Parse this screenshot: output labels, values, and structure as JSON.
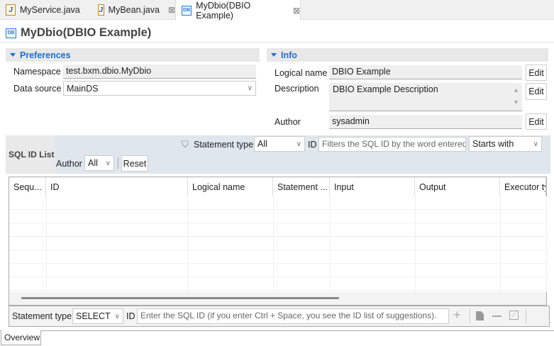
{
  "tabs": [
    {
      "label": "MyService.java",
      "icon": "java-file-warning-icon"
    },
    {
      "label": "MyBean.java",
      "icon": "java-file-warning-icon"
    },
    {
      "label": "MyDbio(DBIO Example)",
      "icon": "dbio-icon",
      "active": true
    }
  ],
  "title": "MyDbio(DBIO Example)",
  "dbicon": "DB",
  "preferences": {
    "header": "Preferences",
    "namespace_label": "Namespace",
    "namespace": "test.bxm.dbio.MyDbio",
    "datasource_label": "Data source",
    "datasource": "MainDS"
  },
  "info": {
    "header": "Info",
    "logical_label": "Logical name",
    "logical": "DBIO Example",
    "desc_label": "Description",
    "desc": "DBIO Example Description",
    "author_label": "Author",
    "author": "sysadmin",
    "edit": "Edit"
  },
  "sqllist": {
    "title": "SQL ID List",
    "stmt_label": "Statement type",
    "stmt": "All",
    "id_label": "ID",
    "id_placeholder": "Filters the SQL ID by the word entered",
    "match": "Starts with",
    "author_label": "Author",
    "author": "All",
    "reset": "Reset"
  },
  "table": {
    "columns": [
      "Sequ...",
      "ID",
      "Logical name",
      "Statement ...",
      "Input",
      "Output",
      "Executor ty"
    ]
  },
  "bottom": {
    "stmt_label": "Statement type",
    "stmt": "SELECT",
    "id_label": "ID",
    "id_placeholder": "Enter the SQL ID (if you enter Ctrl + Space, you see the ID list of suggestions)."
  },
  "footer_tab": "Overview",
  "accent": "#1e6fc8"
}
